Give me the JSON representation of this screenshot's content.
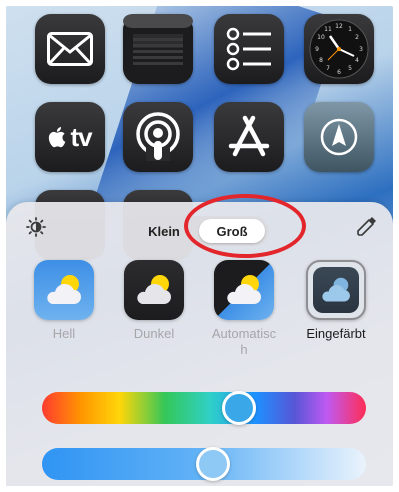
{
  "home_screen": {
    "apps": [
      {
        "name": "mail"
      },
      {
        "name": "wallet"
      },
      {
        "name": "reminders"
      },
      {
        "name": "clock"
      },
      {
        "name": "apple-tv",
        "label": "tv"
      },
      {
        "name": "podcasts"
      },
      {
        "name": "app-store"
      },
      {
        "name": "compass"
      }
    ]
  },
  "sheet": {
    "size_selector": {
      "options": [
        "Klein",
        "Groß"
      ],
      "selected": "Groß"
    },
    "styles": [
      {
        "label": "Hell",
        "icon": "weather-icon-light"
      },
      {
        "label": "Dunkel",
        "icon": "weather-icon-dark"
      },
      {
        "label": "Automatisc\nh",
        "icon": "weather-icon-auto"
      },
      {
        "label": "Eingefärbt",
        "icon": "weather-icon-tinted",
        "selected": true
      }
    ],
    "hue_slider": {
      "value": 0.62
    },
    "brightness_slider": {
      "value": 0.53
    },
    "colors": {
      "highlight_ring": "#e3262b"
    }
  }
}
